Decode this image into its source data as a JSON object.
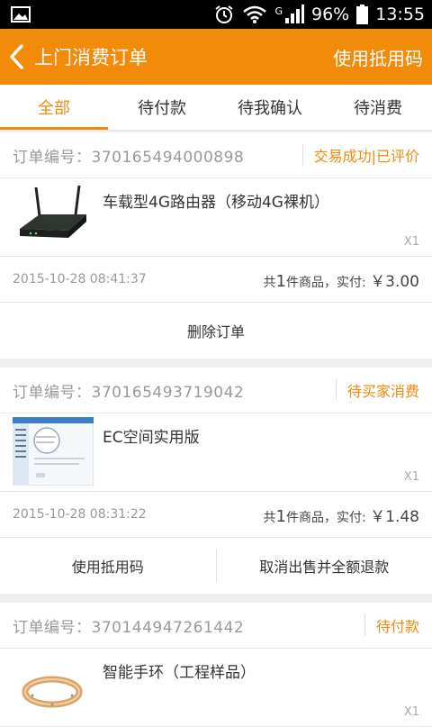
{
  "status_bar": {
    "battery": "96%",
    "time": "13:55",
    "network": "G"
  },
  "app_bar": {
    "title": "上门消费订单",
    "action": "使用抵用码"
  },
  "tabs": [
    {
      "label": "全部",
      "active": true
    },
    {
      "label": "待付款"
    },
    {
      "label": "待我确认"
    },
    {
      "label": "待消费"
    }
  ],
  "orders": [
    {
      "number": "订单编号：370165494000898",
      "status": "交易成功|已评价",
      "product": "车载型4G路由器（移动4G裸机）",
      "qty": "X1",
      "time": "2015-10-28 08:41:37",
      "sum_prefix": "共",
      "count": "1",
      "sum_mid": "件商品，实付:",
      "amount": "￥3.00",
      "actions": [
        "删除订单"
      ]
    },
    {
      "number": "订单编号：370165493719042",
      "status": "待买家消费",
      "product": "EC空间实用版",
      "qty": "X1",
      "time": "2015-10-28 08:31:22",
      "sum_prefix": "共",
      "count": "1",
      "sum_mid": "件商品，实付:",
      "amount": "￥1.48",
      "actions": [
        "使用抵用码",
        "取消出售并全额退款"
      ]
    },
    {
      "number": "订单编号：370144947261442",
      "status": "待付款",
      "product": "智能手环（工程样品）",
      "qty": "X1"
    }
  ],
  "colors": {
    "accent": "#f28a0a"
  }
}
